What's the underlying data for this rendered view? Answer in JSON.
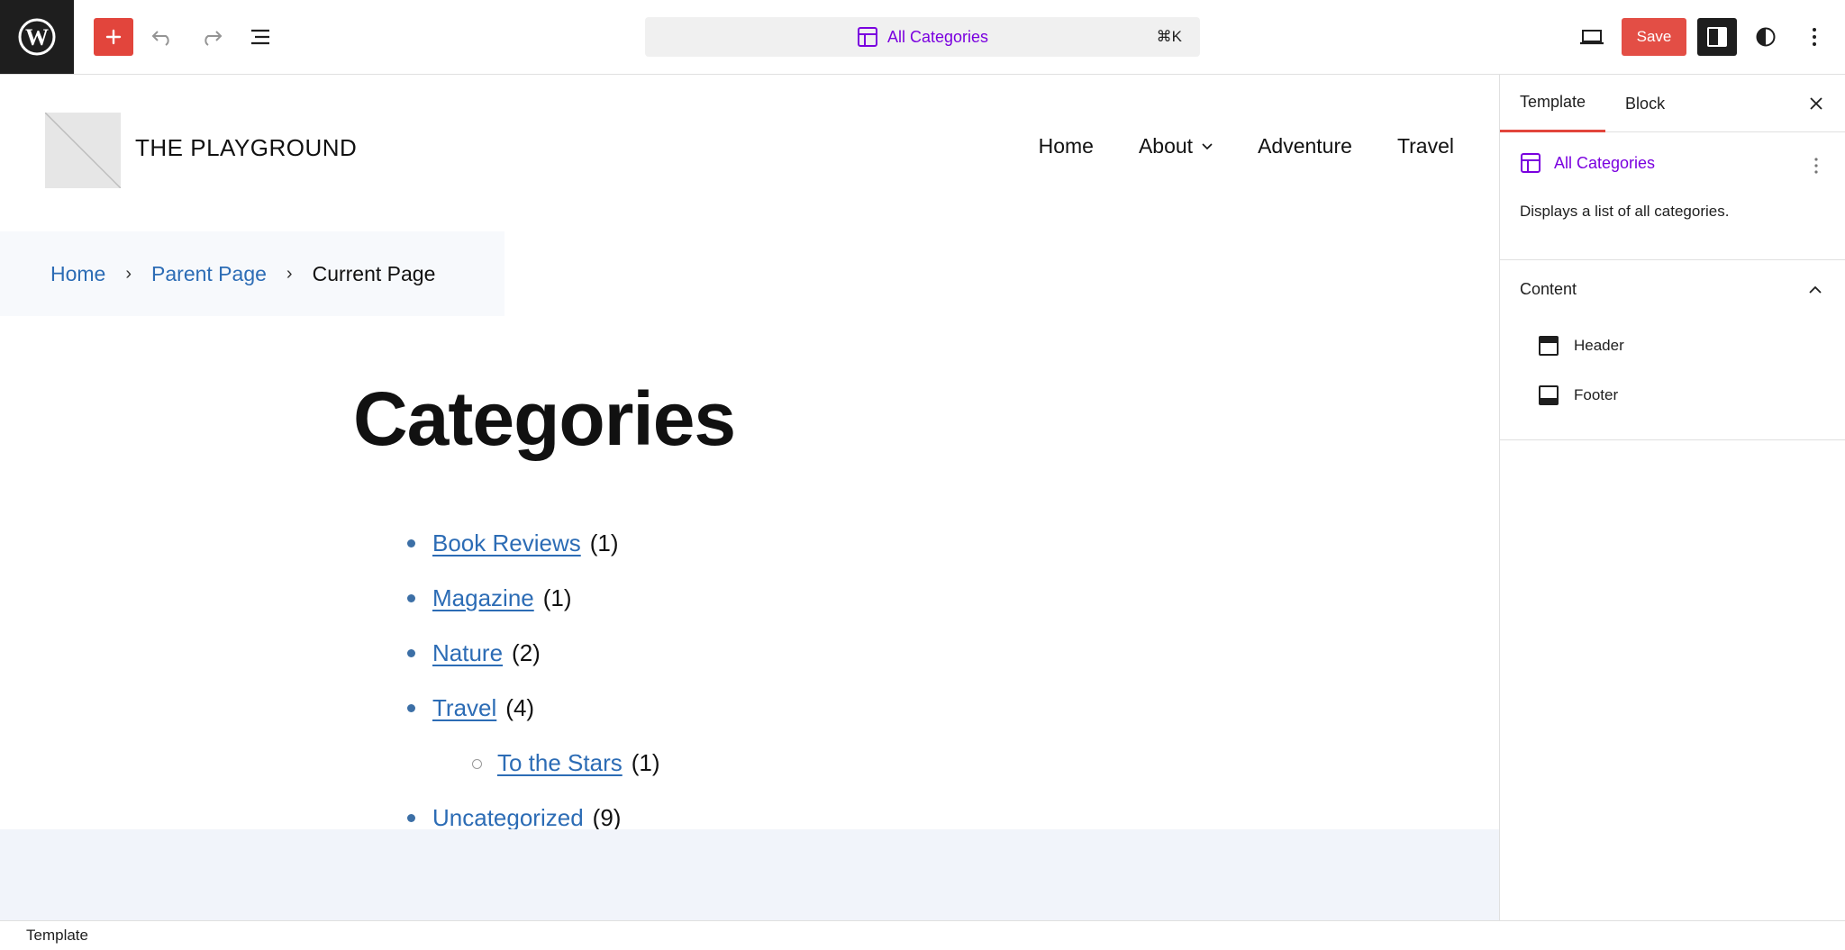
{
  "toolbar": {
    "add_label": "+",
    "command_bar": {
      "label": "All Categories",
      "shortcut": "⌘K"
    },
    "save_label": "Save",
    "accent_color": "#e2453c",
    "command_color": "#7a00df"
  },
  "site": {
    "title": "THE PLAYGROUND",
    "nav": [
      "Home",
      "About",
      "Adventure",
      "Travel"
    ]
  },
  "breadcrumb": {
    "home": "Home",
    "parent": "Parent Page",
    "current": "Current Page"
  },
  "page": {
    "heading": "Categories",
    "categories": [
      {
        "name": "Book Reviews",
        "count": "(1)"
      },
      {
        "name": "Magazine",
        "count": "(1)"
      },
      {
        "name": "Nature",
        "count": "(2)"
      },
      {
        "name": "Travel",
        "count": "(4)"
      },
      {
        "name": "To the Stars",
        "count": "(1)"
      },
      {
        "name": "Uncategorized",
        "count": "(9)"
      }
    ]
  },
  "sidebar": {
    "tabs": [
      "Template",
      "Block"
    ],
    "template_title": "All Categories",
    "template_description": "Displays a list of all categories.",
    "content_heading": "Content",
    "parts": [
      "Header",
      "Footer"
    ]
  },
  "status": {
    "label": "Template"
  }
}
